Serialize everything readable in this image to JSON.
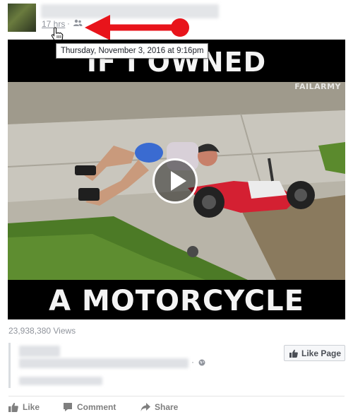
{
  "post": {
    "timestamp_label": "17 hrs",
    "separator": "·",
    "tooltip": "Thursday, November 3, 2016 at 9:16pm",
    "audience_icon": "friends-icon"
  },
  "video": {
    "caption_top": "IF I OWNED",
    "caption_bottom": "A MOTORCYCLE",
    "watermark": "FAILARMY",
    "play_icon": "play-icon"
  },
  "views": "23,938,380 Views",
  "embed": {
    "like_page_label": "Like Page",
    "separator": "·",
    "globe_icon": "globe-icon"
  },
  "actions": {
    "like_label": "Like",
    "comment_label": "Comment",
    "share_label": "Share"
  },
  "colors": {
    "meta_gray": "#90949c",
    "arrow_red": "#e8141b",
    "action_gray": "#7f7f7f"
  }
}
